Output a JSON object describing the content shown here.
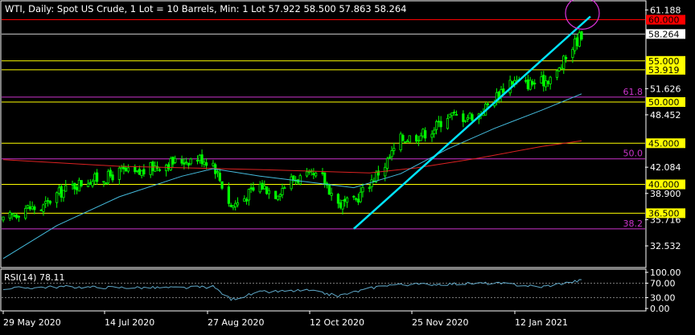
{
  "header": {
    "symbol_line": "WTI, Daily:  Spot US Crude, 1 Lot = 10 Barrels, Min: 1 Lot  57.922 58.500 57.863 58.264"
  },
  "rsi_panel": {
    "label": "RSI(14) 78.11",
    "levels": [
      "100.00",
      "70.00",
      "30.00",
      "0.00"
    ]
  },
  "chart_data": {
    "type": "candlestick",
    "title": "",
    "price_axis_labels": [
      "61.188",
      "51.626",
      "48.452",
      "42.084",
      "38.900",
      "35.716",
      "32.532"
    ],
    "time_axis_labels": [
      "29 May 2020",
      "14 Jul 2020",
      "27 Aug 2020",
      "12 Oct 2020",
      "25 Nov 2020",
      "12 Jan 2021"
    ],
    "ylim": [
      30.0,
      62.2
    ],
    "last_price": 58.264,
    "ohlc": {
      "open": 57.922,
      "high": 58.5,
      "low": 57.863,
      "close": 58.264
    },
    "colors": {
      "background": "#000000",
      "candle": "#00ff00",
      "ma_fast": "#44bbdd",
      "ma_slow": "#dd2222",
      "trendline": "#00e5ff",
      "support_resistance": "#ffff00",
      "resistance_red": "#ff0000",
      "fibonacci": "#cc33cc",
      "rsi_line": "#5fa8c8"
    },
    "horizontal_levels": [
      {
        "value": 60.0,
        "label": "60.000",
        "style": "red"
      },
      {
        "value": 58.264,
        "label": "58.264",
        "style": "current"
      },
      {
        "value": 55.0,
        "label": "55.000",
        "style": "yellow"
      },
      {
        "value": 53.919,
        "label": "53.919",
        "style": "yellow"
      },
      {
        "value": 50.0,
        "label": "50.000",
        "style": "yellow"
      },
      {
        "value": 45.0,
        "label": "45.000",
        "style": "yellow"
      },
      {
        "value": 40.0,
        "label": "40.000",
        "style": "yellow"
      },
      {
        "value": 36.5,
        "label": "36.500",
        "style": "yellow"
      }
    ],
    "fibonacci_levels": [
      {
        "value": 50.6,
        "label": "61.8"
      },
      {
        "value": 43.1,
        "label": "50.0"
      },
      {
        "value": 34.6,
        "label": "38.2"
      }
    ],
    "trendline": {
      "from": {
        "date": "2020-11-02",
        "price": 34.6
      },
      "to": {
        "date": "2021-01-21",
        "price": 60.2
      }
    },
    "closes": [
      {
        "date": "2020-05-29",
        "price": 35.5
      },
      {
        "date": "2020-06-08",
        "price": 37.2
      },
      {
        "date": "2020-06-15",
        "price": 37.0
      },
      {
        "date": "2020-06-22",
        "price": 38.8
      },
      {
        "date": "2020-06-29",
        "price": 39.8
      },
      {
        "date": "2020-07-06",
        "price": 40.5
      },
      {
        "date": "2020-07-14",
        "price": 40.8
      },
      {
        "date": "2020-07-21",
        "price": 41.6
      },
      {
        "date": "2020-07-28",
        "price": 41.2
      },
      {
        "date": "2020-08-04",
        "price": 42.1
      },
      {
        "date": "2020-08-11",
        "price": 42.6
      },
      {
        "date": "2020-08-18",
        "price": 42.9
      },
      {
        "date": "2020-08-25",
        "price": 43.2
      },
      {
        "date": "2020-08-31",
        "price": 42.6
      },
      {
        "date": "2020-09-08",
        "price": 37.3
      },
      {
        "date": "2020-09-14",
        "price": 38.4
      },
      {
        "date": "2020-09-21",
        "price": 39.9
      },
      {
        "date": "2020-09-28",
        "price": 38.9
      },
      {
        "date": "2020-10-05",
        "price": 40.6
      },
      {
        "date": "2020-10-12",
        "price": 40.9
      },
      {
        "date": "2020-10-19",
        "price": 40.8
      },
      {
        "date": "2020-10-26",
        "price": 37.6
      },
      {
        "date": "2020-11-02",
        "price": 37.8
      },
      {
        "date": "2020-11-09",
        "price": 40.2
      },
      {
        "date": "2020-11-16",
        "price": 42.4
      },
      {
        "date": "2020-11-23",
        "price": 45.5
      },
      {
        "date": "2020-11-30",
        "price": 45.9
      },
      {
        "date": "2020-12-07",
        "price": 46.6
      },
      {
        "date": "2020-12-14",
        "price": 48.4
      },
      {
        "date": "2020-12-21",
        "price": 48.2
      },
      {
        "date": "2020-12-28",
        "price": 48.5
      },
      {
        "date": "2021-01-04",
        "price": 50.5
      },
      {
        "date": "2021-01-11",
        "price": 52.6
      },
      {
        "date": "2021-01-18",
        "price": 52.2
      },
      {
        "date": "2021-01-25",
        "price": 52.4
      },
      {
        "date": "2021-02-01",
        "price": 53.5
      },
      {
        "date": "2021-02-08",
        "price": 56.8
      },
      {
        "date": "2021-02-12",
        "price": 58.264
      }
    ],
    "ma_fast": [
      {
        "date": "2020-05-29",
        "price": 31.0
      },
      {
        "date": "2020-06-22",
        "price": 35.0
      },
      {
        "date": "2020-07-20",
        "price": 38.5
      },
      {
        "date": "2020-08-17",
        "price": 41.0
      },
      {
        "date": "2020-08-31",
        "price": 41.9
      },
      {
        "date": "2020-09-21",
        "price": 41.0
      },
      {
        "date": "2020-10-12",
        "price": 40.3
      },
      {
        "date": "2020-11-02",
        "price": 39.6
      },
      {
        "date": "2020-11-23",
        "price": 41.3
      },
      {
        "date": "2020-12-14",
        "price": 44.3
      },
      {
        "date": "2021-01-04",
        "price": 46.8
      },
      {
        "date": "2021-01-25",
        "price": 49.0
      },
      {
        "date": "2021-02-12",
        "price": 51.0
      }
    ],
    "ma_slow": [
      {
        "date": "2020-05-29",
        "price": 43.0
      },
      {
        "date": "2020-07-20",
        "price": 42.2
      },
      {
        "date": "2020-09-21",
        "price": 41.8
      },
      {
        "date": "2020-11-09",
        "price": 41.4
      },
      {
        "date": "2020-11-30",
        "price": 42.0
      },
      {
        "date": "2020-12-28",
        "price": 43.2
      },
      {
        "date": "2021-01-25",
        "price": 44.6
      },
      {
        "date": "2021-02-12",
        "price": 45.3
      }
    ],
    "rsi": [
      {
        "date": "2020-05-29",
        "value": 55
      },
      {
        "date": "2020-06-22",
        "value": 60
      },
      {
        "date": "2020-07-20",
        "value": 58
      },
      {
        "date": "2020-08-17",
        "value": 57
      },
      {
        "date": "2020-08-31",
        "value": 60
      },
      {
        "date": "2020-09-08",
        "value": 25
      },
      {
        "date": "2020-09-21",
        "value": 45
      },
      {
        "date": "2020-10-12",
        "value": 50
      },
      {
        "date": "2020-10-26",
        "value": 35
      },
      {
        "date": "2020-11-16",
        "value": 65
      },
      {
        "date": "2020-12-14",
        "value": 68
      },
      {
        "date": "2021-01-04",
        "value": 70
      },
      {
        "date": "2021-01-25",
        "value": 60
      },
      {
        "date": "2021-02-12",
        "value": 78
      }
    ]
  }
}
